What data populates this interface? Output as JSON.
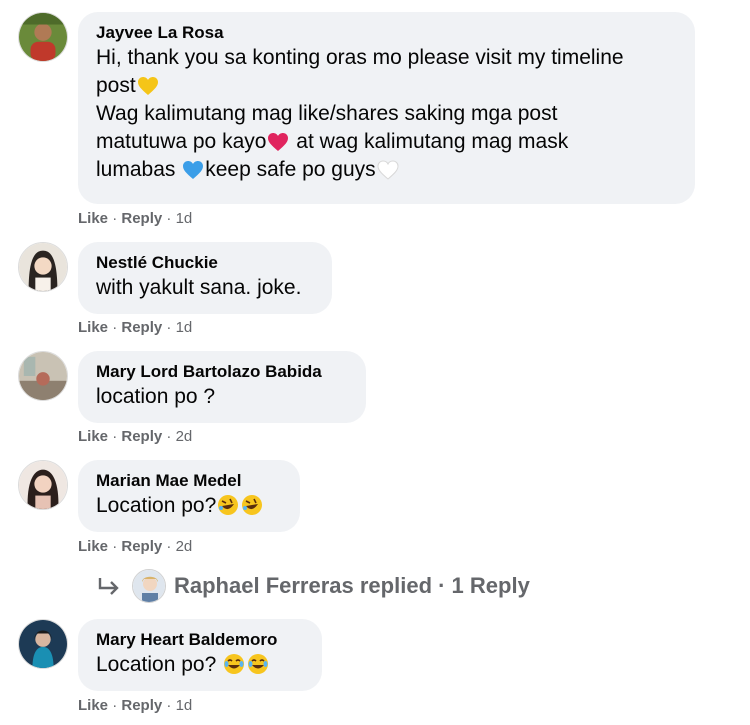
{
  "comments": [
    {
      "author": "Jayvee La Rosa",
      "lines": [
        [
          "Hi, thank you sa konting oras mo please visit my timeline"
        ],
        [
          "post"
        ],
        [
          "Wag kalimutang mag like/shares saking mga post"
        ],
        [
          "matutuwa po kayo",
          " at wag kalimutang mag mask"
        ],
        [
          "lumabas ",
          "keep safe po guys"
        ]
      ],
      "emojis": [
        "yellow-heart",
        "red-heart",
        "blue-heart",
        "white-heart"
      ],
      "like": "Like",
      "reply": "Reply",
      "time": "1d"
    },
    {
      "author": "Nestlé Chuckie",
      "text": "with yakult sana. joke.",
      "like": "Like",
      "reply": "Reply",
      "time": "1d"
    },
    {
      "author": "Mary Lord Bartolazo Babida",
      "text": "location po ?",
      "like": "Like",
      "reply": "Reply",
      "time": "2d"
    },
    {
      "author": "Marian Mae Medel",
      "text": "Location po?",
      "emojis": [
        "rofl-face",
        "rofl-face"
      ],
      "like": "Like",
      "reply": "Reply",
      "time": "2d"
    },
    {
      "author": "Mary Heart Baldemoro",
      "text": "Location po? ",
      "emojis": [
        "tears-of-joy-face",
        "tears-of-joy-face"
      ],
      "like": "Like",
      "reply": "Reply",
      "time": "1d"
    }
  ],
  "reply_summary": {
    "text": "Raphael Ferreras replied · 1 Reply"
  },
  "separator": "·",
  "colors": {
    "bubble": "#f0f2f5",
    "secondary_text": "#65676b",
    "primary_text": "#050505"
  }
}
